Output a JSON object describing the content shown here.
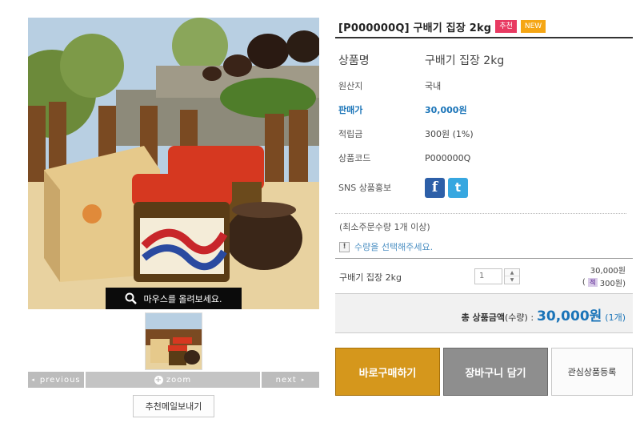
{
  "product": {
    "title": "[P000000Q] 구배기 집장 2kg",
    "badges": {
      "recommend": "추천",
      "new": "NEW"
    }
  },
  "gallery": {
    "zoom_hint": "마우스를 올려보세요.",
    "prev_label": "previous",
    "zoom_label": "zoom",
    "next_label": "next",
    "recommend_mail_label": "추천메일보내기"
  },
  "info": {
    "name_label": "상품명",
    "name_value": "구배기 집장 2kg",
    "origin_label": "원산지",
    "origin_value": "국내",
    "price_label": "판매가",
    "price_value": "30,000원",
    "points_label": "적립금",
    "points_value": "300원 (1%)",
    "code_label": "상품코드",
    "code_value": "P000000Q",
    "sns_label": "SNS 상품홍보",
    "sns_icons": [
      "facebook-icon",
      "twitter-icon"
    ]
  },
  "order": {
    "min_order": "(최소주문수량 1개 이상)",
    "notice": "수량을 선택해주세요.",
    "item_name": "구배기 집장 2kg",
    "quantity": "1",
    "item_price": "30,000원",
    "item_points": "300원)",
    "item_points_prefix": "(",
    "total_label": "총 상품금액",
    "total_qty_label": "(수량) :",
    "total_price": "30,000원",
    "total_count": "(1개)"
  },
  "buttons": {
    "buy": "바로구매하기",
    "cart": "장바구니 담기",
    "wish": "관심상품등록"
  },
  "colors": {
    "accent_blue": "#1a74b8",
    "buy_button": "#d5971c",
    "cart_button": "#8e8e8e",
    "badge_recommend": "#e83a62",
    "badge_new": "#f5a614"
  }
}
